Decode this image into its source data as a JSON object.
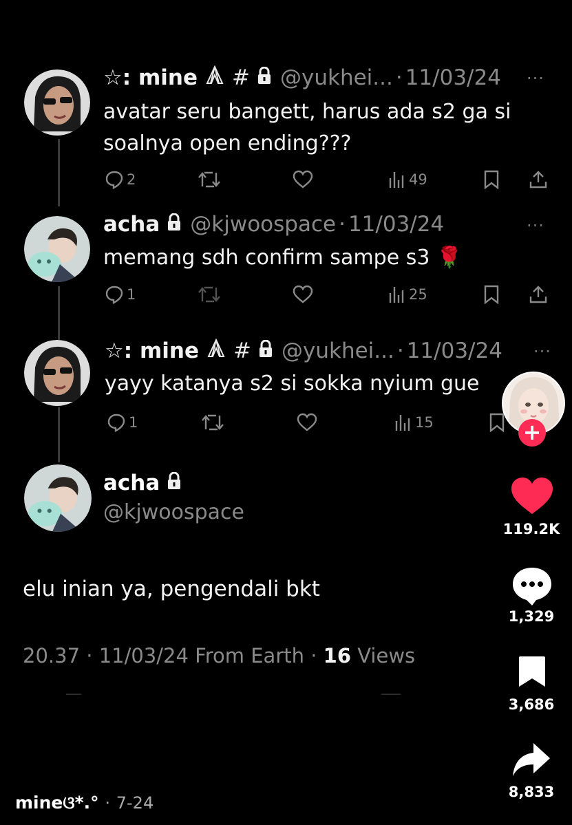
{
  "thread": [
    {
      "name": "☆: mine",
      "hash": "#",
      "handle": "@yukhei...",
      "date": "11/03/24",
      "text_lines": [
        "avatar seru bangett, harus ada s2 ga si",
        "soalnya open ending???"
      ],
      "replies": "2",
      "views": "49",
      "more": "···"
    },
    {
      "name": "acha",
      "handle": "@kjwoospace",
      "date": "11/03/24",
      "text_lines": [
        "memang sdh confirm sampe s3 🌹"
      ],
      "replies": "1",
      "views": "25",
      "more": "···"
    },
    {
      "name": "☆: mine",
      "hash": "#",
      "handle": "@yukhei...",
      "date": "11/03/24",
      "text_lines": [
        "yayy katanya s2 si sokka nyium gue"
      ],
      "replies": "1",
      "views": "15",
      "more": "···"
    }
  ],
  "main_tweet": {
    "name": "acha",
    "handle": "@kjwoospace",
    "text": "elu inian ya, pengendali bkt",
    "time": "20.37",
    "date": "11/03/24",
    "source": "From Earth",
    "views_count": "16",
    "views_label": "Views",
    "sep": "·"
  },
  "sidebar": {
    "likes": "119.2K",
    "comments": "1,329",
    "saves": "3,686",
    "shares": "8,833",
    "follow_plus": "+",
    "like_color": "#fe2c55"
  },
  "footer": {
    "username": "mine",
    "suffix": "ଓ*.°",
    "sep": "·",
    "date": "7-24"
  }
}
